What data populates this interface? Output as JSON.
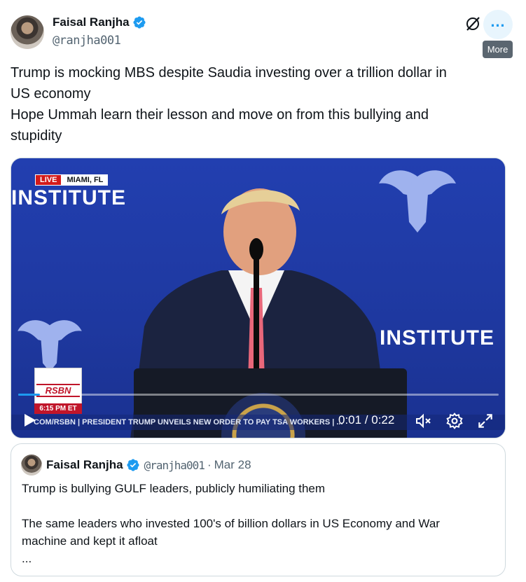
{
  "author": {
    "name": "Faisal Ranjha",
    "handle": "@ranjha001"
  },
  "actions": {
    "more_tooltip": "More"
  },
  "tweet": {
    "lines": [
      "Trump is mocking MBS despite Saudia investing over a trillion dollar in",
      "US economy",
      "Hope Ummah learn their lesson and move on from this bullying and",
      "stupidity"
    ]
  },
  "video": {
    "live_label": "LIVE",
    "location": "MIAMI, FL",
    "brand_left": "INSTITUTE",
    "brand_right": "FI INSTITUTE",
    "bug_name": "RSBN",
    "bug_time": "6:15 PM ET",
    "ticker": "COM/RSBN  |  PRESIDENT TRUMP UNVEILS NEW ORDER TO PAY TSA WORKERS  |  ...",
    "time_display": "0:01 / 0:22",
    "progress": 0.045,
    "accent_color": "#1d9bf0"
  },
  "quoted": {
    "name": "Faisal Ranjha",
    "handle": "@ranjha001",
    "separator": "·",
    "date": "Mar 28",
    "lines": [
      "Trump is bullying GULF leaders, publicly humiliating them",
      "",
      "The same leaders who invested 100's of billion dollars in US Economy and War",
      "machine and kept it afloat",
      "..."
    ]
  }
}
